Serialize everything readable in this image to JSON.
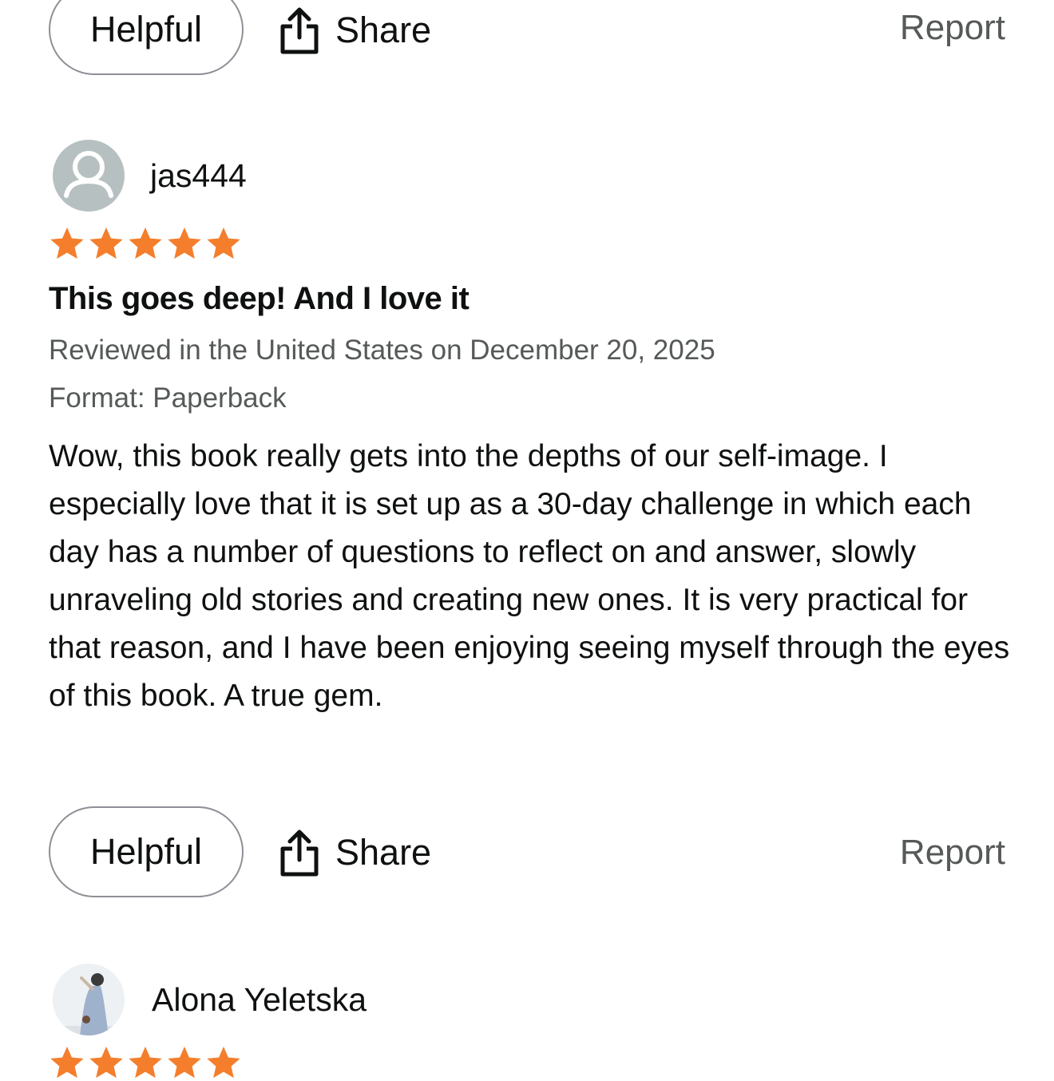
{
  "actions_top": {
    "helpful_label": "Helpful",
    "share_label": "Share",
    "report_label": "Report"
  },
  "review": {
    "username": "jas444",
    "rating": 5,
    "rating_max": 5,
    "title": "This goes deep! And I love it",
    "reviewed_line": "Reviewed in the United States on December 20, 2025",
    "format_line": "Format: Paperback",
    "body": "Wow, this book really gets into the depths of our self-image. I especially love that it is set up as a 30-day challenge in which each day has a number of questions to reflect on and answer, slowly unraveling old stories and creating new ones. It is very practical for that reason, and I have been enjoying seeing myself through the eyes of this book. A true gem.",
    "star_color": "#f47e2c",
    "avatar_icon": "person-icon"
  },
  "actions": {
    "helpful_label": "Helpful",
    "share_label": "Share",
    "report_label": "Report"
  },
  "next_review": {
    "username": "Alona Yeletska",
    "avatar_icon": "profile-photo"
  }
}
